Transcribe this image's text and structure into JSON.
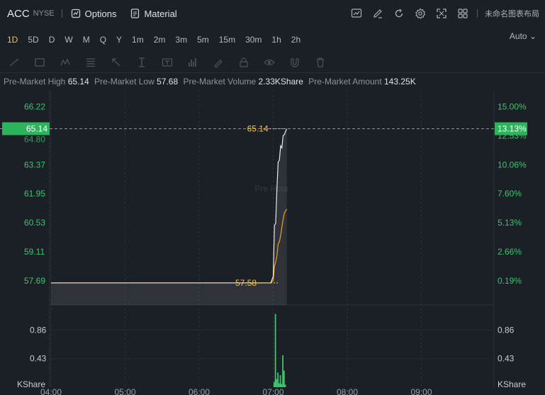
{
  "header": {
    "symbol": "ACC",
    "exchange": "NYSE",
    "options_label": "Options",
    "material_label": "Material",
    "layout_name": "未命名图表布局",
    "icons": [
      "chart-icon",
      "edit-icon",
      "refresh-icon",
      "gear-icon",
      "fullscreen-icon",
      "grid-icon",
      "chevron-down-icon"
    ]
  },
  "timeframes": {
    "items": [
      "1D",
      "5D",
      "D",
      "W",
      "M",
      "Q",
      "Y",
      "1m",
      "2m",
      "3m",
      "5m",
      "15m",
      "30m",
      "1h",
      "2h"
    ],
    "active": "1D",
    "scale_mode": "Auto"
  },
  "stats": {
    "high_label": "Pre-Market High",
    "high_value": "65.14",
    "low_label": "Pre-Market Low",
    "low_value": "57.68",
    "volume_label": "Pre-Market Volume",
    "volume_value": "2.33KShare",
    "amount_label": "Pre-Market Amount",
    "amount_value": "143.25K"
  },
  "colors": {
    "background": "#1b1f26",
    "price_line": "#e8e8e8",
    "avg_line": "#f0a020",
    "up_green": "#3ec46d",
    "current_badge": "#2bb45a",
    "active_tab": "#f2c14e"
  },
  "chart_data": {
    "type": "line",
    "watermark": "Pre Hour",
    "x_ticks": [
      "04:00",
      "05:00",
      "06:00",
      "07:00",
      "08:00",
      "09:00"
    ],
    "y_ticks": [
      66.22,
      63.37,
      61.95,
      60.53,
      59.11,
      57.69
    ],
    "y_ticks_hidden": [
      "64.80"
    ],
    "pct_ticks": [
      "15.00%",
      "12.53%",
      "10.06%",
      "7.60%",
      "5.13%",
      "2.66%",
      "0.19%"
    ],
    "ylim": [
      56.5,
      67.0
    ],
    "current_price": "65.14",
    "current_pct": "13.13%",
    "annot_high": "65.14",
    "annot_low": "57.58",
    "series": [
      {
        "name": "price",
        "x": [
          "04:00",
          "06:58",
          "07:00",
          "07:01",
          "07:02",
          "07:03",
          "07:04",
          "07:05",
          "07:06",
          "07:07",
          "07:08",
          "07:09",
          "07:10",
          "07:11"
        ],
        "values": [
          57.58,
          57.58,
          57.9,
          60.4,
          60.5,
          62.2,
          63.5,
          63.6,
          64.3,
          64.2,
          64.8,
          64.85,
          65.0,
          65.14
        ]
      },
      {
        "name": "average",
        "x": [
          "04:00",
          "06:58",
          "07:00",
          "07:01",
          "07:02",
          "07:03",
          "07:04",
          "07:05",
          "07:06",
          "07:07",
          "07:08",
          "07:09",
          "07:10",
          "07:11"
        ],
        "values": [
          57.58,
          57.58,
          57.7,
          58.4,
          58.6,
          58.9,
          59.5,
          59.6,
          59.9,
          60.3,
          60.7,
          61.0,
          61.1,
          61.2
        ]
      }
    ],
    "volume": {
      "unit": "KShare",
      "ticks": [
        0.86,
        0.43
      ],
      "ylim": [
        0,
        1.13
      ],
      "x": [
        "07:00",
        "07:01",
        "07:02",
        "07:03",
        "07:04",
        "07:05",
        "07:06",
        "07:07",
        "07:08",
        "07:09"
      ],
      "values": [
        0.08,
        1.1,
        0.12,
        0.22,
        0.06,
        0.18,
        0.05,
        0.48,
        0.25,
        0.04
      ]
    }
  }
}
